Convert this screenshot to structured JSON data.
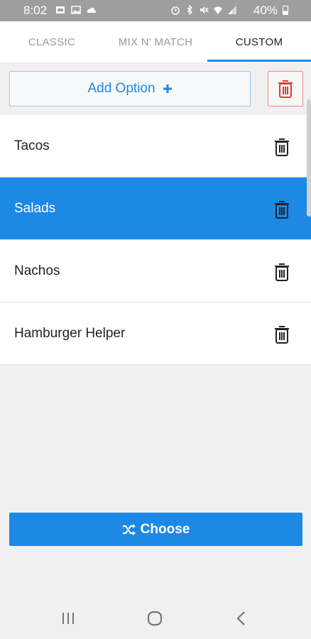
{
  "status_bar": {
    "time": "8:02",
    "battery": "40%",
    "left_icons": [
      "app-notification-icon",
      "image-icon",
      "cloud-icon"
    ],
    "right_icons": [
      "alarm-icon",
      "bluetooth-icon",
      "mute-icon",
      "wifi-icon",
      "signal-icon"
    ]
  },
  "tabs": [
    {
      "label": "CLASSIC",
      "active": false
    },
    {
      "label": "MIX N' MATCH",
      "active": false
    },
    {
      "label": "CUSTOM",
      "active": true
    }
  ],
  "toolbar": {
    "add_label": "Add Option",
    "add_icon": "plus-icon",
    "delete_all_icon": "trash-icon"
  },
  "options": [
    {
      "label": "Tacos",
      "selected": false
    },
    {
      "label": "Salads",
      "selected": true
    },
    {
      "label": "Nachos",
      "selected": false
    },
    {
      "label": "Hamburger Helper",
      "selected": false
    }
  ],
  "choose": {
    "label": "Choose",
    "icon": "shuffle-icon"
  },
  "colors": {
    "accent": "#1e88e5",
    "danger": "#e53935",
    "background": "#f0f0f0",
    "status_bar": "#9e9e9e"
  }
}
